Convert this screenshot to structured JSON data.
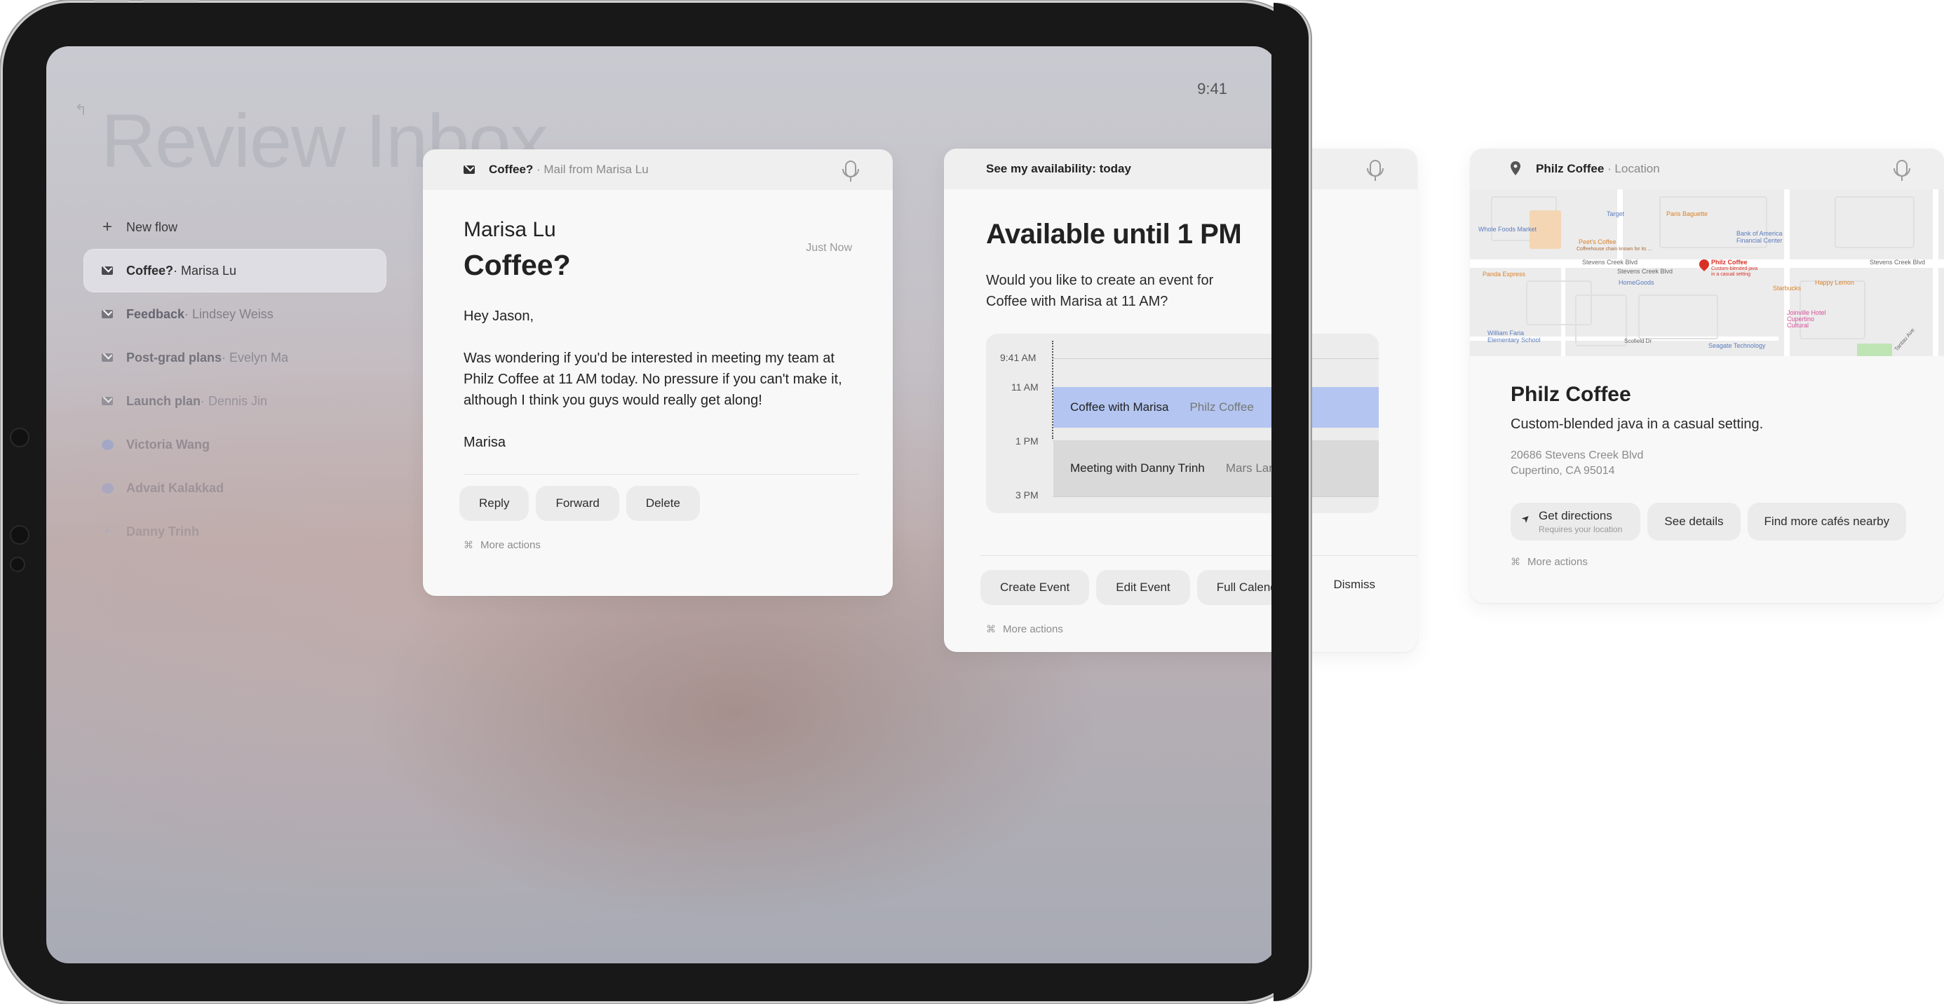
{
  "status_time": "9:41",
  "page_title": "Review Inbox",
  "sidebar": {
    "new_flow": "New flow",
    "items": [
      {
        "title": "Coffee?",
        "sub": " · Marisa Lu"
      },
      {
        "title": "Feedback",
        "sub": " · Lindsey Weiss"
      },
      {
        "title": "Post-grad plans",
        "sub": " · Evelyn Ma"
      },
      {
        "title": "Launch plan",
        "sub": " · Dennis Jin"
      },
      {
        "title": "Victoria Wang",
        "sub": ""
      },
      {
        "title": "Advait Kalakkad",
        "sub": ""
      },
      {
        "title": "Danny Trinh",
        "sub": ""
      }
    ]
  },
  "mail_card": {
    "header_title": "Coffee?",
    "header_sub": " · Mail from Marisa Lu",
    "sender": "Marisa Lu",
    "time": "Just Now",
    "subject": "Coffee?",
    "greeting": "Hey Jason,",
    "body": "Was wondering if you'd be interested in meeting my team at Philz Coffee at 11 AM today. No pressure if you can't make it, although I think you guys would really get along!",
    "signature": "Marisa",
    "actions": [
      "Reply",
      "Forward",
      "Delete"
    ],
    "more": "More actions"
  },
  "calendar_card": {
    "header_title": "See my availability: today",
    "title": "Available until 1 PM",
    "question": "Would you like to create an event for Coffee with Marisa at 11 AM?",
    "time_labels": [
      "9:41 AM",
      "11 AM",
      "1 PM",
      "3 PM"
    ],
    "events": [
      {
        "title": "Coffee with Marisa",
        "location": "Philz Coffee",
        "color": "#b3c5f0"
      },
      {
        "title": "Meeting with Danny Trinh",
        "location": "Mars Landing",
        "color": "#d9d9d9"
      }
    ],
    "actions": [
      "Create Event",
      "Edit Event",
      "Full Calendar"
    ],
    "dismiss": "Dismiss",
    "more": "More actions"
  },
  "location_card": {
    "header_title": "Philz Coffee",
    "header_sub": " · Location",
    "map_labels": {
      "whole_foods": "Whole Foods Market",
      "target": "Target",
      "paris_baguette": "Paris Baguette",
      "peets": "Peet's Coffee",
      "peets_desc": "Coffeehouse chain known for its ...",
      "bank": "Bank of America Financial Center",
      "panda": "Panda Express",
      "stevens1": "Stevens Creek Blvd",
      "stevens2": "Stevens Creek Blvd",
      "stevens3": "Stevens Creek Blvd",
      "philz_pin": "Philz Coffee",
      "philz_pin_desc": "Custom-blended java in a casual setting",
      "homegoods": "HomeGoods",
      "starbucks": "Starbucks",
      "happy_lemon": "Happy Lemon",
      "joinville": "Joinville Hotel Cupertino Cultural",
      "william_faria": "William Faria Elementary School",
      "seagate": "Seagate Technology",
      "scofield": "Scofield Dr",
      "tantau": "Tantau Ave"
    },
    "title": "Philz Coffee",
    "description": "Custom-blended java in a casual setting.",
    "address_line1": "20686 Stevens Creek Blvd",
    "address_line2": "Cupertino, CA 95014",
    "directions": "Get directions",
    "directions_sub": "Requires your location",
    "see_details": "See details",
    "find_more": "Find more cafés nearby",
    "more": "More actions"
  }
}
